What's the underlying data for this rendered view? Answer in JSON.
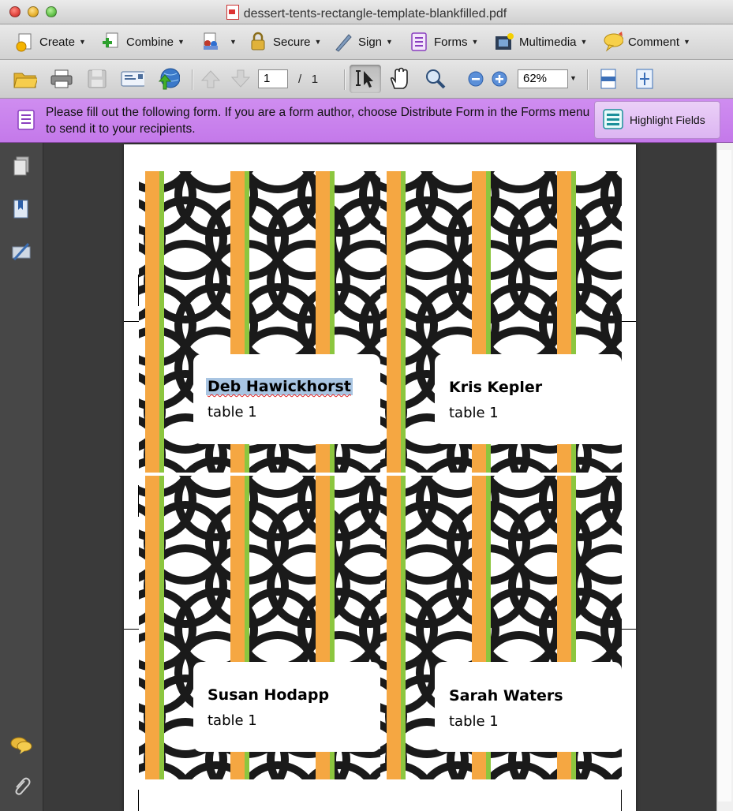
{
  "window": {
    "title": "dessert-tents-rectangle-template-blankfilled.pdf"
  },
  "toolbar": {
    "items": [
      {
        "label": "Create",
        "icon": "create-icon"
      },
      {
        "label": "Combine",
        "icon": "combine-icon"
      },
      {
        "label": "",
        "icon": "collaborate-icon"
      },
      {
        "label": "Secure",
        "icon": "lock-icon"
      },
      {
        "label": "Sign",
        "icon": "pen-icon"
      },
      {
        "label": "Forms",
        "icon": "forms-icon"
      },
      {
        "label": "Multimedia",
        "icon": "film-icon"
      },
      {
        "label": "Comment",
        "icon": "comment-bubble-icon"
      }
    ]
  },
  "nav": {
    "current_page": "1",
    "page_sep": "/",
    "total_pages": "1",
    "zoom": "62%"
  },
  "formbar": {
    "message": "Please fill out the following form. If you are a form author, choose Distribute Form in the Forms menu to send it to your recipients.",
    "highlight_label": "Highlight Fields"
  },
  "tents": [
    {
      "name": "Deb Hawickhorst",
      "table": "table 1"
    },
    {
      "name": "Kris Kepler",
      "table": "table 1"
    },
    {
      "name": "Susan Hodapp",
      "table": "table 1"
    },
    {
      "name": "Sarah Waters",
      "table": "table 1"
    }
  ],
  "colors": {
    "orange": "#f5a742",
    "green": "#8cc63f",
    "form_bar": "#c884ed",
    "pattern_black": "#1a1a1a"
  }
}
